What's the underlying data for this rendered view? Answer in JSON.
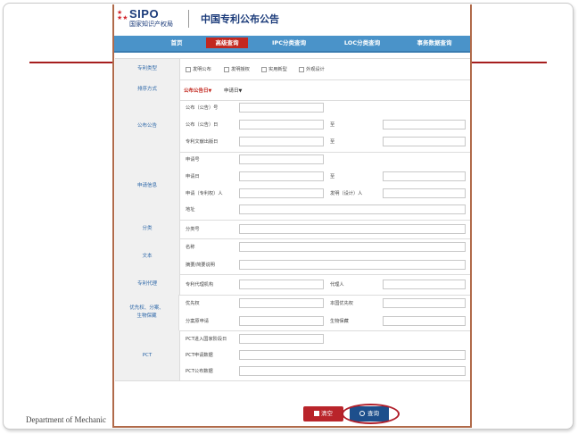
{
  "slide": {
    "footer_text": "Department of Mechanic"
  },
  "header": {
    "logo_en": "SIPO",
    "logo_cn": "国家知识产权局",
    "title": "中国专利公布公告"
  },
  "nav": {
    "items": [
      {
        "label": "首页",
        "active": false
      },
      {
        "label": "高级查询",
        "active": true
      },
      {
        "label": "IPC分类查询",
        "active": false
      },
      {
        "label": "LOC分类查询",
        "active": false
      },
      {
        "label": "事务数据查询",
        "active": false
      }
    ]
  },
  "form": {
    "patent_type": {
      "label": "专利类型",
      "options": [
        "发明公布",
        "发明授权",
        "实用新型",
        "外观设计"
      ]
    },
    "sort": {
      "label": "排序方式",
      "primary": "公布公告日",
      "secondary": "申请日"
    },
    "publication": {
      "label": "公布公告",
      "number": "公布（公告）号",
      "date": "公布（公告）日",
      "to": "至",
      "doc_date": "专利文献出版日",
      "to2": "至"
    },
    "application": {
      "label": "申请信息",
      "number": "申请号",
      "date": "申请日",
      "to": "至",
      "applicant": "申请（专利权）人",
      "inventor": "发明（设计）人",
      "address": "地址"
    },
    "classification": {
      "label": "分类",
      "code": "分类号"
    },
    "text": {
      "label": "文本",
      "name": "名称",
      "abstract": "摘要/简要说明"
    },
    "agency": {
      "label": "专利代理",
      "org": "专利代理机构",
      "agent": "代理人"
    },
    "priority": {
      "label": "优先权、分案、生物保藏",
      "priority": "优先权",
      "domestic": "本国优先权",
      "divisional": "分案原申请",
      "bio": "生物保藏"
    },
    "pct": {
      "label": "PCT",
      "entry_date": "PCT进入国家阶段日",
      "app_data": "PCT申请数据",
      "pub_data": "PCT公布数据"
    }
  },
  "buttons": {
    "clear": "清空",
    "search": "查询"
  },
  "colors": {
    "accent_red": "#c3281f",
    "nav_blue": "#4a93c9",
    "search_blue": "#1d4f8c",
    "label_blue": "#2d67a8"
  },
  "icons": {
    "clear": "trash-icon",
    "search": "magnifier-icon"
  }
}
